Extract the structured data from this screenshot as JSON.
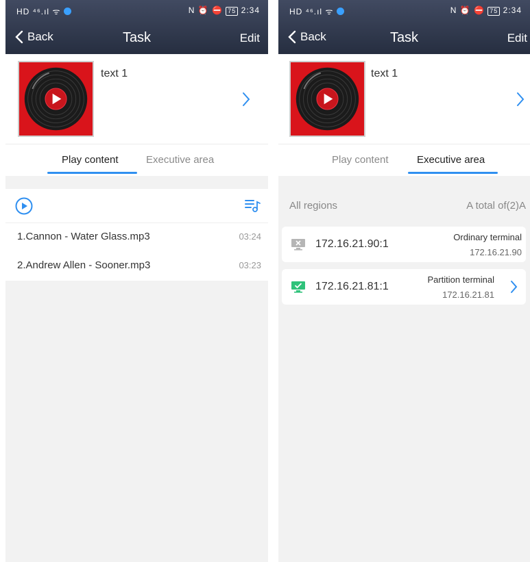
{
  "status_bar": {
    "left": "HD ⁴⁶.ıl",
    "right": "N ⏰ ⛔",
    "battery": "75",
    "time": "2:34"
  },
  "nav": {
    "back_label": "Back",
    "title": "Task",
    "edit_label": "Edit"
  },
  "task": {
    "name": "text 1"
  },
  "tabs": [
    {
      "label": "Play content"
    },
    {
      "label": "Executive area"
    }
  ],
  "left_screen": {
    "active_tab": "Play content",
    "songs": [
      {
        "name": "1.Cannon - Water Glass.mp3",
        "duration": "03:24"
      },
      {
        "name": "2.Andrew Allen - Sooner.mp3",
        "duration": "03:23"
      }
    ]
  },
  "right_screen": {
    "active_tab": "Executive area",
    "regions": {
      "label": "All regions",
      "total": "A total of(2)A"
    },
    "terminals": [
      {
        "address": "172.16.21.90:1",
        "type": "Ordinary terminal",
        "ip": "172.16.21.90",
        "status": "offline",
        "icon": "monitor-offline-icon"
      },
      {
        "address": "172.16.21.81:1",
        "type": "Partition terminal",
        "ip": "172.16.21.81",
        "status": "online",
        "icon": "monitor-online-icon"
      }
    ]
  },
  "colors": {
    "accent": "#2f8ff0",
    "header_top": "#414a61",
    "header_bottom": "#262e40",
    "album_red": "#d9141b",
    "online_green": "#2fc27a",
    "offline_gray": "#b5b5b5"
  }
}
